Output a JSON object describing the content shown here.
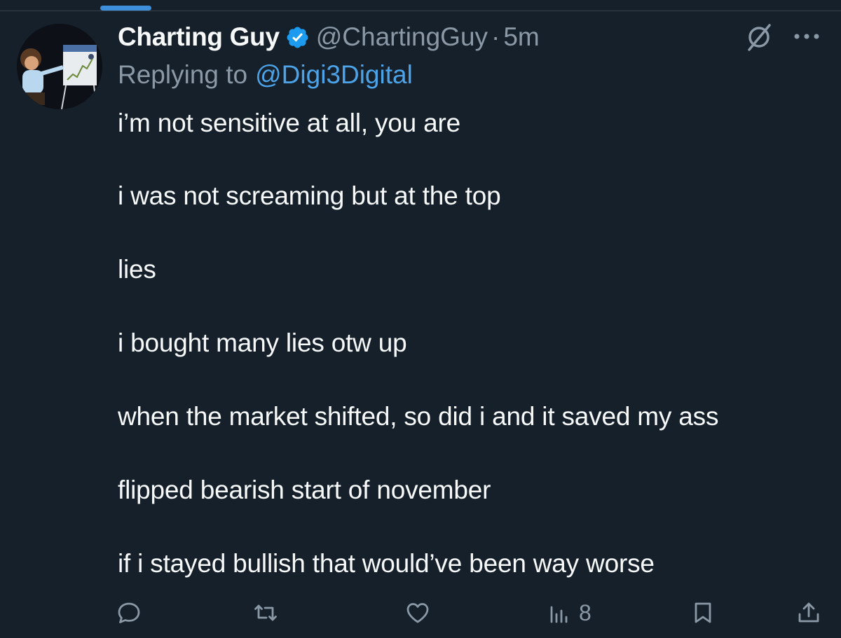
{
  "tweet": {
    "display_name": "Charting Guy",
    "handle": "@ChartingGuy",
    "separator": "·",
    "time": "5m",
    "replying_label": "Replying to",
    "replying_to": "@Digi3Digital",
    "lines": [
      "i’m not sensitive at all, you are",
      "i was not screaming but at the top",
      "lies",
      "i bought many lies otw up",
      "when the market shifted, so did i and it saved my ass",
      "flipped bearish start of november",
      "if i stayed bullish that would’ve been way worse"
    ]
  },
  "actions": {
    "reply_icon": "reply-icon",
    "retweet_icon": "retweet-icon",
    "like_icon": "heart-icon",
    "views_icon": "views-icon",
    "views_count": "8",
    "bookmark_icon": "bookmark-icon",
    "share_icon": "share-icon"
  },
  "colors": {
    "background": "#15202b",
    "text": "#f7f9f9",
    "muted": "#8b98a5",
    "link": "#4ca3e8",
    "verified": "#1d9bf0"
  }
}
